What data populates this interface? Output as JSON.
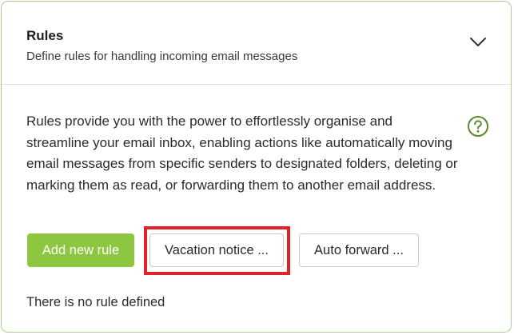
{
  "section": {
    "title": "Rules",
    "subtitle": "Define rules for handling incoming email messages",
    "collapse_icon": "chevron-down-icon"
  },
  "content": {
    "description": "Rules provide you with the power to effortlessly organise and streamline your email inbox, enabling actions like automatically moving email messages from specific senders to designated folders, deleting or marking them as read, or forwarding them to another email address.",
    "help_icon": "question-circle-icon",
    "buttons": {
      "add_rule": "Add new rule",
      "vacation_notice": "Vacation notice ...",
      "auto_forward": "Auto forward ..."
    },
    "empty_state": "There is no rule defined"
  },
  "colors": {
    "accent": "#8dc63f",
    "card_border": "#a9d08e",
    "highlight": "#e0232a",
    "help_icon": "#5a8a2a"
  }
}
